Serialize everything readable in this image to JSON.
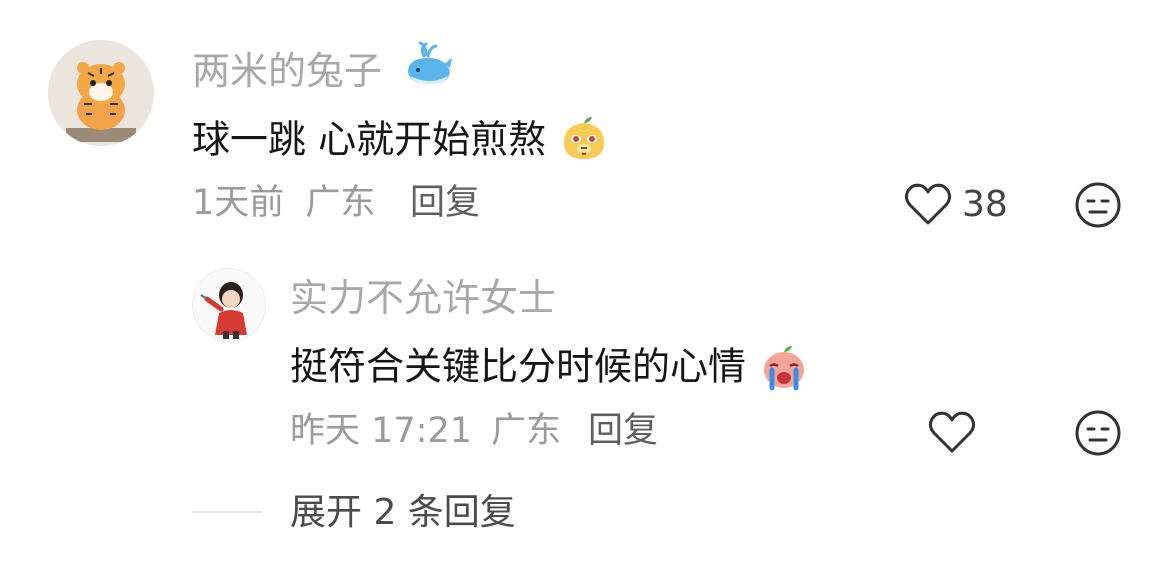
{
  "comments": [
    {
      "username": "两米的兔子",
      "text": "球一跳 心就开始煎熬",
      "time": "1天前",
      "location": "广东",
      "reply_label": "回复",
      "likes": "38",
      "badge_icon": "whale-icon",
      "text_emoji": "smirk-face-emoji"
    }
  ],
  "replies": [
    {
      "username": "实力不允许女士",
      "text": "挺符合关键比分时候的心情",
      "time": "昨天 17:21",
      "location": "广东",
      "reply_label": "回复",
      "text_emoji": "crying-face-emoji"
    }
  ],
  "expand": {
    "label": "展开 2 条回复"
  }
}
